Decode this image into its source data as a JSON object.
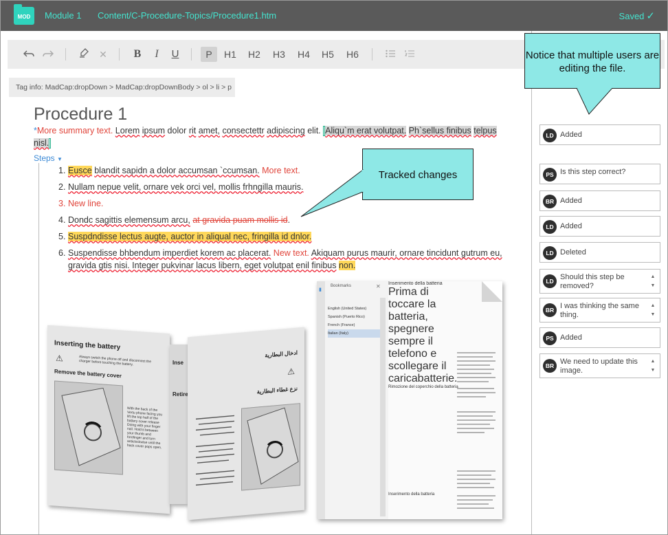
{
  "topbar": {
    "mod_icon_label": "MOD",
    "module_title": "Module 1",
    "file_path": "Content/C-Procedure-Topics/Procedure1.htm",
    "saved_label": "Saved",
    "saved_icon": "checkmark-icon",
    "accent_color": "#44e4cf"
  },
  "toolbar": {
    "undo_icon": "undo-icon",
    "redo_icon": "redo-icon",
    "brush_icon": "brush-icon",
    "clear_icon": "clear-format-icon",
    "bold": "B",
    "italic": "I",
    "underline": "U",
    "paragraph": "P",
    "h1": "H1",
    "h2": "H2",
    "h3": "H3",
    "h4": "H4",
    "h5": "H5",
    "h6": "H6",
    "bullet_list_icon": "bullet-list-icon",
    "numbered_list_icon": "numbered-list-icon"
  },
  "taginfo": "Tag info: MadCap:dropDown > MadCap:dropDownBody > ol > li > p",
  "document": {
    "title": "Procedure 1",
    "summary_asterisk": "*",
    "summary_new": "More summary text.",
    "summary_words": [
      "Lorem",
      "ipsum",
      "dolor",
      "rit",
      "amet,",
      "consectettr",
      "adipiscing",
      "elit."
    ],
    "summary_hl": [
      "Aliqu`m erat volutpat.",
      "Ph`sellus finibus",
      "telpus nisl."
    ],
    "steps_label": "Steps",
    "steps": [
      {
        "num": "1.",
        "hl": "Eusce",
        "text": "blandit sapidn a dolor accumsan `ccumsan.",
        "new": "More text."
      },
      {
        "num": "2.",
        "text": "Nullam nepue velit, ornare vek orci vel, mollis frhngilla mauris."
      },
      {
        "num": "3.",
        "new": "New line."
      },
      {
        "num": "4.",
        "text": "Dondc sagittis elemensum arcu,",
        "del": "at gravida puam mollis id",
        "end": "."
      },
      {
        "num": "5.",
        "hl": "Suspdndisse lectus augte, auctor in aliqual nec, fringilla id  dnlor."
      },
      {
        "num": "6.",
        "text": "Suspendisse bhbendum imperdiet korem ac placerat.",
        "new": "New text.",
        "text2": "Akiquam purus maurir, ornare tincidunt gutrum eu, gravida gtis nisi. Integer pukvinar lacus libern, eget volutpat enil finibus",
        "hl_end": "non."
      }
    ]
  },
  "callouts": {
    "users": "Notice that multiple users are editing the file.",
    "tracked": "Tracked changes"
  },
  "comments": [
    {
      "initials": "LD",
      "text": "Added"
    },
    {
      "initials": "PS",
      "text": "Is this step correct?"
    },
    {
      "initials": "BR",
      "text": "Added"
    },
    {
      "initials": "LD",
      "text": "Added"
    },
    {
      "initials": "LD",
      "text": "Deleted"
    },
    {
      "initials": "LD",
      "text": "Should this step be removed?"
    },
    {
      "initials": "BR",
      "text": "I was thinking the same thing."
    },
    {
      "initials": "PS",
      "text": "Added"
    },
    {
      "initials": "BR",
      "text": "We need to update this image."
    }
  ],
  "images": {
    "page1_title": "Inserting the battery",
    "page1_text1": "Always switch the phone off and disconnect the charger before touching the battery.",
    "page1_title2": "Remove the battery cover",
    "page1_text2": "With the back of the Vertu phone facing you lift the top half of the battery cover release Doing with your finger nail. Hold it between your thumb and forefinger and turn anticlockwise until the back cover pops open.",
    "page2_title": "ادخال البطارية",
    "page2_title2": "نزع غطاء البطارية",
    "page2_frag1": "Inse",
    "page2_frag2": "Retire",
    "bookmarks_title": "Bookmarks",
    "bookmarks_items": [
      "English (United States)",
      "Spanish (Puerto Rico)",
      "French (France)",
      "Italian (Italy)"
    ],
    "page3_title": "Inserimento della batteria",
    "page3_text1": "Prima di toccare la batteria, spegnere sempre il telefono e scollegare il caricabatterie.",
    "page3_title2": "Rimozione del coperchio della batteria",
    "page3_title3": "Inserimento della batteria"
  }
}
